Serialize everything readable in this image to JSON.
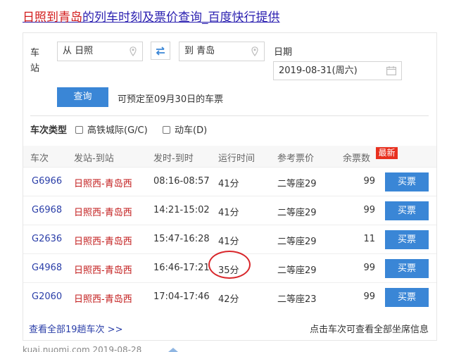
{
  "page": {
    "title_part1": "日照到",
    "title_part2": "青岛",
    "title_part3": "的列车时刻及票价查询_百度快行提供"
  },
  "search": {
    "station_label": "车站",
    "from_value": "从 日照",
    "to_value": "到 青岛",
    "date_label": "日期",
    "date_value": "2019-08-31(周六)",
    "query_button": "查询",
    "advance_note": "可预定至09月30日的车票"
  },
  "filters": {
    "label": "车次类型",
    "options": [
      {
        "label": "高铁城际(G/C)",
        "checked": false
      },
      {
        "label": "动车(D)",
        "checked": false
      }
    ]
  },
  "table": {
    "columns": [
      "车次",
      "发站-到站",
      "发时-到时",
      "运行时间",
      "参考票价",
      "余票数"
    ],
    "new_badge": "最新",
    "buy_label": "买票",
    "rows": [
      {
        "train": "G6966",
        "from": "日照西",
        "to": "青岛西",
        "time": "08:16-08:57",
        "duration": "41分",
        "price": "二等座29",
        "remaining": "99"
      },
      {
        "train": "G6968",
        "from": "日照西",
        "to": "青岛西",
        "time": "14:21-15:02",
        "duration": "41分",
        "price": "二等座29",
        "remaining": "99"
      },
      {
        "train": "G2636",
        "from": "日照西",
        "to": "青岛西",
        "time": "15:47-16:28",
        "duration": "41分",
        "price": "二等座29",
        "remaining": "11"
      },
      {
        "train": "G4968",
        "from": "日照西",
        "to": "青岛西",
        "time": "16:46-17:21",
        "duration": "35分",
        "price": "二等座29",
        "remaining": "99"
      },
      {
        "train": "G2060",
        "from": "日照西",
        "to": "青岛西",
        "time": "17:04-17:46",
        "duration": "42分",
        "price": "二等座23",
        "remaining": "99"
      }
    ]
  },
  "footer": {
    "view_all": "查看全部19趟车次 >>",
    "hint": "点击车次可查看全部坐席信息"
  },
  "source": {
    "text": "kuai.nuomi.com 2019-08-28"
  },
  "colors": {
    "accent": "#3a86d6",
    "link": "#2a3ea8",
    "station": "#c21b1b",
    "highlight_circle": "#d8262a",
    "badge": "#e8301f"
  }
}
